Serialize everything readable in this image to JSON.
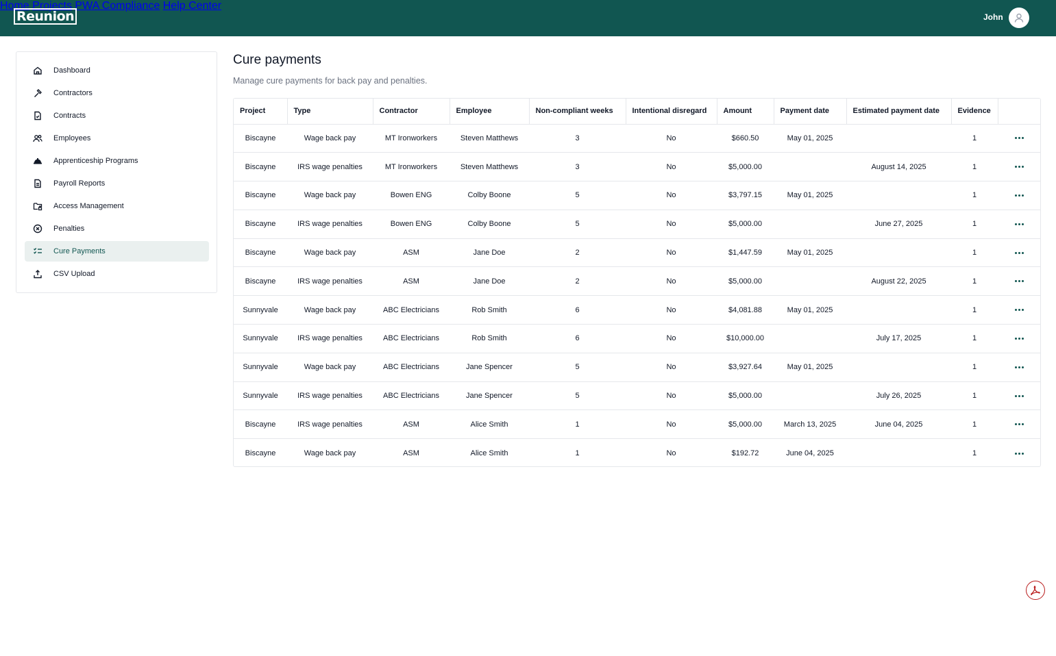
{
  "header": {
    "logo_text": "Reunion",
    "nav": [
      "Home",
      "Projects",
      "PWA Compliance",
      "Help Center"
    ],
    "user_name": "John"
  },
  "sidebar": {
    "items": [
      {
        "label": "Dashboard",
        "icon": "home-icon"
      },
      {
        "label": "Contractors",
        "icon": "hammer-icon"
      },
      {
        "label": "Contracts",
        "icon": "document-check-icon"
      },
      {
        "label": "Employees",
        "icon": "users-icon"
      },
      {
        "label": "Apprenticeship Programs",
        "icon": "hard-hat-icon"
      },
      {
        "label": "Payroll Reports",
        "icon": "report-icon"
      },
      {
        "label": "Access Management",
        "icon": "folder-lock-icon"
      },
      {
        "label": "Penalties",
        "icon": "circle-x-icon"
      },
      {
        "label": "Cure Payments",
        "icon": "checklist-icon",
        "active": true
      },
      {
        "label": "CSV Upload",
        "icon": "upload-icon"
      }
    ]
  },
  "main": {
    "title": "Cure payments",
    "subtitle": "Manage cure payments for back pay and penalties."
  },
  "table": {
    "columns": [
      "Project",
      "Type",
      "Contractor",
      "Employee",
      "Non-compliant weeks",
      "Intentional disregard",
      "Amount",
      "Payment date",
      "Estimated payment date",
      "Evidence",
      ""
    ],
    "rows": [
      [
        "Biscayne",
        "Wage back pay",
        "MT Ironworkers",
        "Steven Matthews",
        "3",
        "No",
        "$660.50",
        "May 01, 2025",
        "",
        "1"
      ],
      [
        "Biscayne",
        "IRS wage penalties",
        "MT Ironworkers",
        "Steven Matthews",
        "3",
        "No",
        "$5,000.00",
        "",
        "August 14, 2025",
        "1"
      ],
      [
        "Biscayne",
        "Wage back pay",
        "Bowen ENG",
        "Colby Boone",
        "5",
        "No",
        "$3,797.15",
        "May 01, 2025",
        "",
        "1"
      ],
      [
        "Biscayne",
        "IRS wage penalties",
        "Bowen ENG",
        "Colby Boone",
        "5",
        "No",
        "$5,000.00",
        "",
        "June 27, 2025",
        "1"
      ],
      [
        "Biscayne",
        "Wage back pay",
        "ASM",
        "Jane Doe",
        "2",
        "No",
        "$1,447.59",
        "May 01, 2025",
        "",
        "1"
      ],
      [
        "Biscayne",
        "IRS wage penalties",
        "ASM",
        "Jane Doe",
        "2",
        "No",
        "$5,000.00",
        "",
        "August 22, 2025",
        "1"
      ],
      [
        "Sunnyvale",
        "Wage back pay",
        "ABC Electricians",
        "Rob Smith",
        "6",
        "No",
        "$4,081.88",
        "May 01, 2025",
        "",
        "1"
      ],
      [
        "Sunnyvale",
        "IRS wage penalties",
        "ABC Electricians",
        "Rob Smith",
        "6",
        "No",
        "$10,000.00",
        "",
        "July 17, 2025",
        "1"
      ],
      [
        "Sunnyvale",
        "Wage back pay",
        "ABC Electricians",
        "Jane Spencer",
        "5",
        "No",
        "$3,927.64",
        "May 01, 2025",
        "",
        "1"
      ],
      [
        "Sunnyvale",
        "IRS wage penalties",
        "ABC Electricians",
        "Jane Spencer",
        "5",
        "No",
        "$5,000.00",
        "",
        "July 26, 2025",
        "1"
      ],
      [
        "Biscayne",
        "IRS wage penalties",
        "ASM",
        "Alice Smith",
        "1",
        "No",
        "$5,000.00",
        "March 13, 2025",
        "June 04, 2025",
        "1"
      ],
      [
        "Biscayne",
        "Wage back pay",
        "ASM",
        "Alice Smith",
        "1",
        "No",
        "$192.72",
        "June 04, 2025",
        "",
        "1"
      ]
    ]
  },
  "colors": {
    "brand": "#115651",
    "active_bg": "#eaf0ef",
    "pdf_red": "#b91c1c"
  }
}
